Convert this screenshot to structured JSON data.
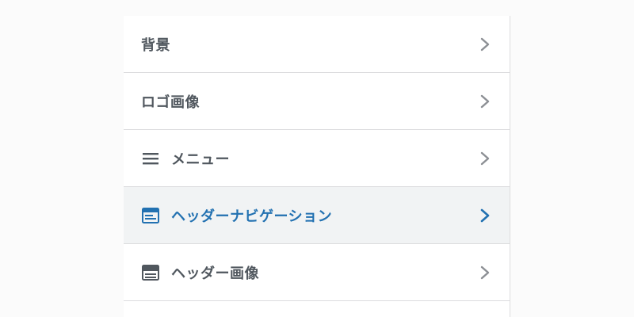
{
  "menu": {
    "items": [
      {
        "label": "背景",
        "icon": "none",
        "active": false
      },
      {
        "label": "ロゴ画像",
        "icon": "none",
        "active": false
      },
      {
        "label": "メニュー",
        "icon": "menu-lines-icon",
        "active": false
      },
      {
        "label": "ヘッダーナビゲーション",
        "icon": "header-nav-icon",
        "active": true
      },
      {
        "label": "ヘッダー画像",
        "icon": "header-image-icon",
        "active": false
      }
    ]
  },
  "colors": {
    "text": "#50575e",
    "active_text": "#2271b1",
    "chevron": "#8c8f94",
    "active_chevron": "#2271b1",
    "active_bg": "#f1f3f4",
    "divider": "#dcdcde"
  }
}
